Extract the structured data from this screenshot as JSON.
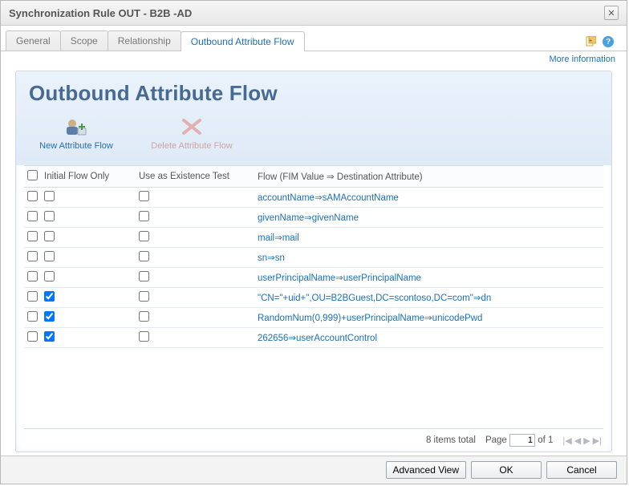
{
  "window": {
    "title": "Synchronization Rule OUT - B2B -AD"
  },
  "tabs": {
    "general": "General",
    "scope": "Scope",
    "relationship": "Relationship",
    "outbound": "Outbound Attribute Flow"
  },
  "moreinfo": "More information",
  "panel": {
    "title": "Outbound Attribute Flow"
  },
  "toolbar": {
    "new": "New Attribute Flow",
    "delete": "Delete Attribute Flow"
  },
  "columns": {
    "initial": "Initial Flow Only",
    "existence": "Use as Existence Test",
    "flow": "Flow (FIM Value ⇒ Destination Attribute)"
  },
  "rows": [
    {
      "initial": false,
      "existence": false,
      "flow": "accountName⇒sAMAccountName"
    },
    {
      "initial": false,
      "existence": false,
      "flow": "givenName⇒givenName"
    },
    {
      "initial": false,
      "existence": false,
      "flow": "mail⇒mail"
    },
    {
      "initial": false,
      "existence": false,
      "flow": "sn⇒sn"
    },
    {
      "initial": false,
      "existence": false,
      "flow": "userPrincipalName⇒userPrincipalName"
    },
    {
      "initial": true,
      "existence": false,
      "flow": "\"CN=\"+uid+\",OU=B2BGuest,DC=scontoso,DC=com\"⇒dn"
    },
    {
      "initial": true,
      "existence": false,
      "flow": "RandomNum(0,999)+userPrincipalName⇒unicodePwd"
    },
    {
      "initial": true,
      "existence": false,
      "flow": "262656⇒userAccountControl"
    }
  ],
  "footer": {
    "total": "8 items total",
    "page_label": "Page",
    "page_value": "1",
    "page_of": "of 1"
  },
  "buttons": {
    "advanced": "Advanced View",
    "ok": "OK",
    "cancel": "Cancel"
  }
}
